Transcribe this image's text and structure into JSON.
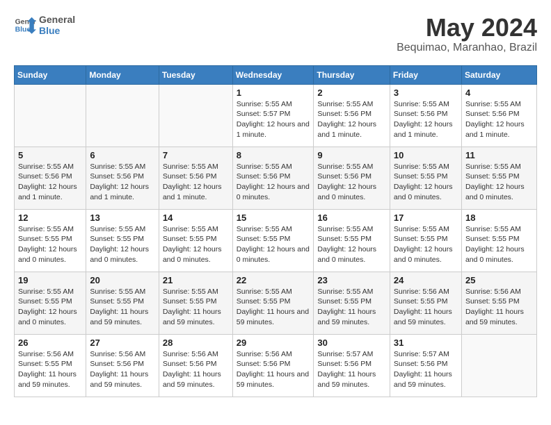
{
  "header": {
    "logo_line1": "General",
    "logo_line2": "Blue",
    "month_year": "May 2024",
    "location": "Bequimao, Maranhao, Brazil"
  },
  "weekdays": [
    "Sunday",
    "Monday",
    "Tuesday",
    "Wednesday",
    "Thursday",
    "Friday",
    "Saturday"
  ],
  "weeks": [
    [
      {
        "day": "",
        "info": ""
      },
      {
        "day": "",
        "info": ""
      },
      {
        "day": "",
        "info": ""
      },
      {
        "day": "1",
        "info": "Sunrise: 5:55 AM\nSunset: 5:57 PM\nDaylight: 12 hours and 1 minute."
      },
      {
        "day": "2",
        "info": "Sunrise: 5:55 AM\nSunset: 5:56 PM\nDaylight: 12 hours and 1 minute."
      },
      {
        "day": "3",
        "info": "Sunrise: 5:55 AM\nSunset: 5:56 PM\nDaylight: 12 hours and 1 minute."
      },
      {
        "day": "4",
        "info": "Sunrise: 5:55 AM\nSunset: 5:56 PM\nDaylight: 12 hours and 1 minute."
      }
    ],
    [
      {
        "day": "5",
        "info": "Sunrise: 5:55 AM\nSunset: 5:56 PM\nDaylight: 12 hours and 1 minute."
      },
      {
        "day": "6",
        "info": "Sunrise: 5:55 AM\nSunset: 5:56 PM\nDaylight: 12 hours and 1 minute."
      },
      {
        "day": "7",
        "info": "Sunrise: 5:55 AM\nSunset: 5:56 PM\nDaylight: 12 hours and 1 minute."
      },
      {
        "day": "8",
        "info": "Sunrise: 5:55 AM\nSunset: 5:56 PM\nDaylight: 12 hours and 0 minutes."
      },
      {
        "day": "9",
        "info": "Sunrise: 5:55 AM\nSunset: 5:56 PM\nDaylight: 12 hours and 0 minutes."
      },
      {
        "day": "10",
        "info": "Sunrise: 5:55 AM\nSunset: 5:55 PM\nDaylight: 12 hours and 0 minutes."
      },
      {
        "day": "11",
        "info": "Sunrise: 5:55 AM\nSunset: 5:55 PM\nDaylight: 12 hours and 0 minutes."
      }
    ],
    [
      {
        "day": "12",
        "info": "Sunrise: 5:55 AM\nSunset: 5:55 PM\nDaylight: 12 hours and 0 minutes."
      },
      {
        "day": "13",
        "info": "Sunrise: 5:55 AM\nSunset: 5:55 PM\nDaylight: 12 hours and 0 minutes."
      },
      {
        "day": "14",
        "info": "Sunrise: 5:55 AM\nSunset: 5:55 PM\nDaylight: 12 hours and 0 minutes."
      },
      {
        "day": "15",
        "info": "Sunrise: 5:55 AM\nSunset: 5:55 PM\nDaylight: 12 hours and 0 minutes."
      },
      {
        "day": "16",
        "info": "Sunrise: 5:55 AM\nSunset: 5:55 PM\nDaylight: 12 hours and 0 minutes."
      },
      {
        "day": "17",
        "info": "Sunrise: 5:55 AM\nSunset: 5:55 PM\nDaylight: 12 hours and 0 minutes."
      },
      {
        "day": "18",
        "info": "Sunrise: 5:55 AM\nSunset: 5:55 PM\nDaylight: 12 hours and 0 minutes."
      }
    ],
    [
      {
        "day": "19",
        "info": "Sunrise: 5:55 AM\nSunset: 5:55 PM\nDaylight: 12 hours and 0 minutes."
      },
      {
        "day": "20",
        "info": "Sunrise: 5:55 AM\nSunset: 5:55 PM\nDaylight: 11 hours and 59 minutes."
      },
      {
        "day": "21",
        "info": "Sunrise: 5:55 AM\nSunset: 5:55 PM\nDaylight: 11 hours and 59 minutes."
      },
      {
        "day": "22",
        "info": "Sunrise: 5:55 AM\nSunset: 5:55 PM\nDaylight: 11 hours and 59 minutes."
      },
      {
        "day": "23",
        "info": "Sunrise: 5:55 AM\nSunset: 5:55 PM\nDaylight: 11 hours and 59 minutes."
      },
      {
        "day": "24",
        "info": "Sunrise: 5:56 AM\nSunset: 5:55 PM\nDaylight: 11 hours and 59 minutes."
      },
      {
        "day": "25",
        "info": "Sunrise: 5:56 AM\nSunset: 5:55 PM\nDaylight: 11 hours and 59 minutes."
      }
    ],
    [
      {
        "day": "26",
        "info": "Sunrise: 5:56 AM\nSunset: 5:55 PM\nDaylight: 11 hours and 59 minutes."
      },
      {
        "day": "27",
        "info": "Sunrise: 5:56 AM\nSunset: 5:56 PM\nDaylight: 11 hours and 59 minutes."
      },
      {
        "day": "28",
        "info": "Sunrise: 5:56 AM\nSunset: 5:56 PM\nDaylight: 11 hours and 59 minutes."
      },
      {
        "day": "29",
        "info": "Sunrise: 5:56 AM\nSunset: 5:56 PM\nDaylight: 11 hours and 59 minutes."
      },
      {
        "day": "30",
        "info": "Sunrise: 5:57 AM\nSunset: 5:56 PM\nDaylight: 11 hours and 59 minutes."
      },
      {
        "day": "31",
        "info": "Sunrise: 5:57 AM\nSunset: 5:56 PM\nDaylight: 11 hours and 59 minutes."
      },
      {
        "day": "",
        "info": ""
      }
    ]
  ]
}
